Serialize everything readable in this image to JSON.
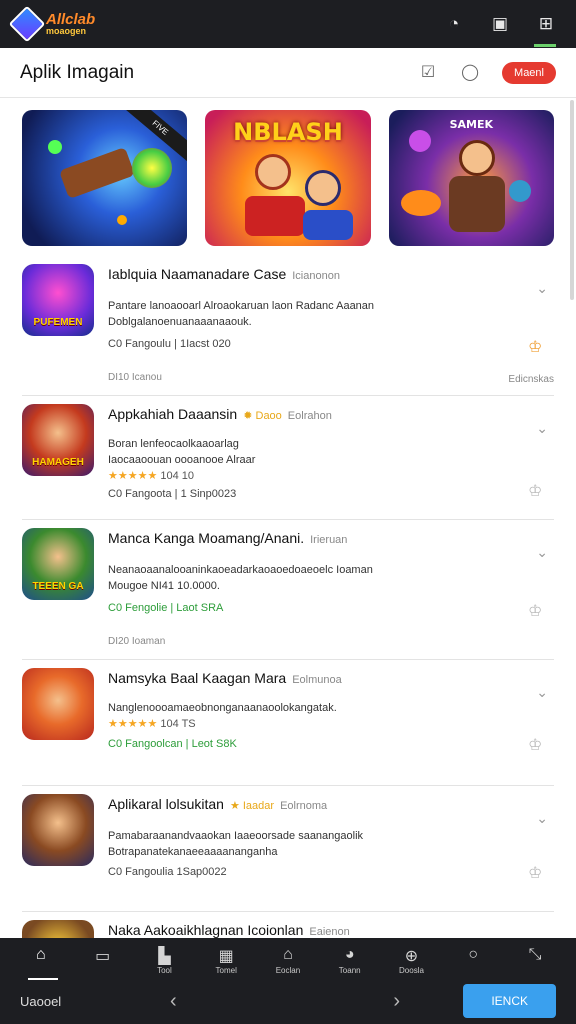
{
  "topbar": {
    "logo_line1": "Allclab",
    "logo_line2": "moaogen",
    "icons": [
      "clock-icon",
      "window-icon",
      "settings-icon"
    ]
  },
  "header": {
    "title": "Aplik Imagain",
    "button_label": "Maenl"
  },
  "banners": [
    {
      "title": "",
      "ribbon": "FIVE"
    },
    {
      "title": "NBLASH",
      "ribbon": ""
    },
    {
      "title": "SAMEK",
      "ribbon": ""
    }
  ],
  "apps": [
    {
      "title": "Iablquia Naamanadare Case",
      "tag": "Icianonon",
      "desc_line1": "Pantare lanoaooarl Alroaokaruan laon Radanc Aaanan",
      "desc_line2": "Doblgalanoenuanaaanaaouk.",
      "rating": "",
      "rating_num": "",
      "meta": "C0 Fangoulu | 1Iacst 020",
      "foot_left": "DI10 Icanou",
      "foot_right": "Edicnskas",
      "icon_label": "PUFEMEN",
      "green": false
    },
    {
      "title": "Appkahiah Daaansin",
      "tag": "Eolrahon",
      "star_tag": "Daoo",
      "desc_line1": "Boran lenfeocaolkaaoarlag",
      "desc_line2": "Iaocaaoouan oooanooe Alraar",
      "rating": "★★★★★",
      "rating_num": "104 10",
      "meta": "C0 Fangoota | 1 Sinp0023",
      "foot_left": "",
      "foot_right": "",
      "icon_label": "HAMAGEH",
      "green": false
    },
    {
      "title": "Manca Kanga Moamang/Anani.",
      "tag": "Irieruan",
      "desc_line1": "Neanaoaanalooaninkaoeadarkaoaoedoaeoelc Ioaman",
      "desc_line2": "Mougoe NI41 10.0000.",
      "rating": "",
      "rating_num": "",
      "meta": "C0 Fengolie | Laot SRA",
      "foot_left": "DI20 Ioaman",
      "foot_right": "",
      "icon_label": "TEEEN GA",
      "green": true
    },
    {
      "title": "Namsyka Baal Kaagan Mara",
      "tag": "Eolmunoa",
      "desc_line1": "Nanglenoooamaeobnonganaanaoolokangatak.",
      "desc_line2": "",
      "rating": "★★★★★",
      "rating_num": "104 TS",
      "meta": "C0 Fangoolcan | Leot S8K",
      "foot_left": "",
      "foot_right": "",
      "icon_label": "",
      "green": true
    },
    {
      "title": "Aplikaral lolsukitan",
      "tag": "Eolrnoma",
      "star_tag": "Iaadar",
      "desc_line1": "Pamabaraanandvaaokan Iaaeoorsade saanangaolik",
      "desc_line2": "Botrapanatekanaeeaaaananganha",
      "rating": "",
      "rating_num": "",
      "meta": "C0 Fangoulia 1Sap0022",
      "foot_left": "",
      "foot_right": "",
      "icon_label": "",
      "green": false
    },
    {
      "title": "Naka Aakoaikhlagnan Icoionlan",
      "tag": "Eaienon",
      "desc_line1": "",
      "desc_line2": "",
      "rating": "",
      "rating_num": "",
      "meta": "",
      "foot_left": "",
      "foot_right": "",
      "icon_label": "",
      "green": false
    }
  ],
  "bottom_nav": {
    "items": [
      {
        "label": "",
        "icon": "home-icon"
      },
      {
        "label": "",
        "icon": "card-icon"
      },
      {
        "label": "Tool",
        "icon": "store-icon"
      },
      {
        "label": "Tomel",
        "icon": "grid-icon"
      },
      {
        "label": "Eoclan",
        "icon": "shop-icon"
      },
      {
        "label": "Toann",
        "icon": "clock-icon"
      },
      {
        "label": "Doosla",
        "icon": "globe-icon"
      },
      {
        "label": "",
        "icon": "search-icon"
      },
      {
        "label": "",
        "icon": "expand-icon"
      }
    ],
    "left_label": "Uaooel",
    "cta_label": "IENCK"
  }
}
